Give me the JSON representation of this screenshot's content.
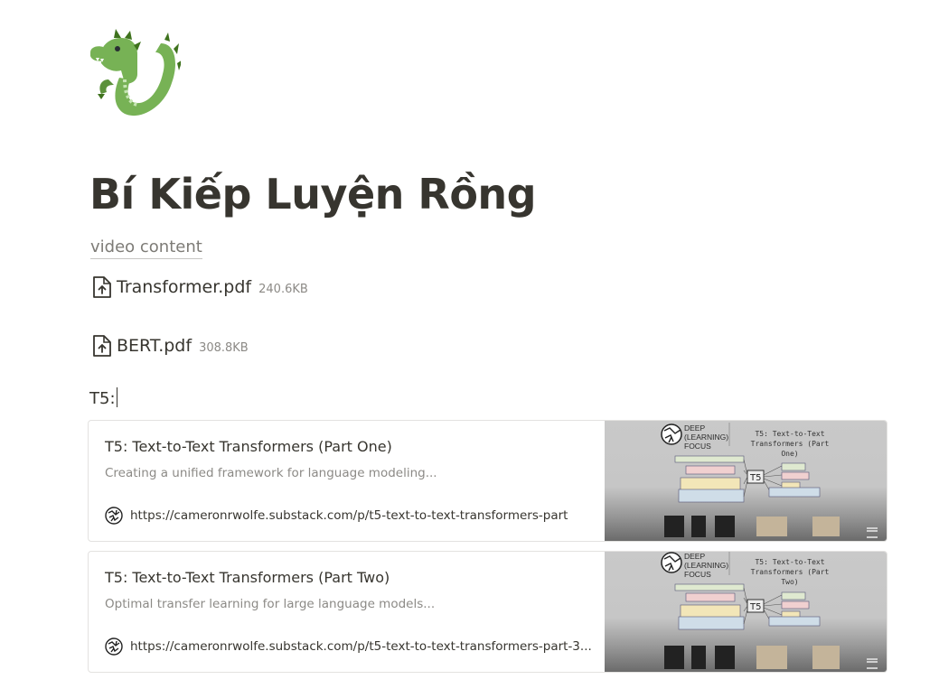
{
  "page": {
    "icon": "dragon-emoji-icon",
    "title": "Bí Kiếp Luyện Rồng",
    "link_text": "video content"
  },
  "files": [
    {
      "name": "Transformer.pdf",
      "size": "240.6KB",
      "icon": "file-upload-icon"
    },
    {
      "name": "BERT.pdf",
      "size": "308.8KB",
      "icon": "file-upload-icon"
    }
  ],
  "t5_label": "T5:",
  "bookmarks": [
    {
      "title": "T5: Text-to-Text Transformers (Part One)",
      "description": "Creating a unified framework for language modeling...",
      "url": "https://cameronrwolfe.substack.com/p/t5-text-to-text-transformers-part",
      "thumb_brand": [
        "DEEP",
        "(LEARNING)",
        "FOCUS"
      ],
      "thumb_title": [
        "T5: Text-to-Text",
        "Transformers (Part One)"
      ]
    },
    {
      "title": "T5: Text-to-Text Transformers (Part Two)",
      "description": "Optimal transfer learning for large language models...",
      "url": "https://cameronrwolfe.substack.com/p/t5-text-to-text-transformers-part-3...",
      "thumb_brand": [
        "DEEP",
        "(LEARNING)",
        "FOCUS"
      ],
      "thumb_title": [
        "T5: Text-to-Text",
        "Transformers (Part Two)"
      ]
    }
  ],
  "colors": {
    "text": "#37352f",
    "muted": "#8c8a86",
    "dragon": "#77b255",
    "border": "#e3e2e0"
  }
}
